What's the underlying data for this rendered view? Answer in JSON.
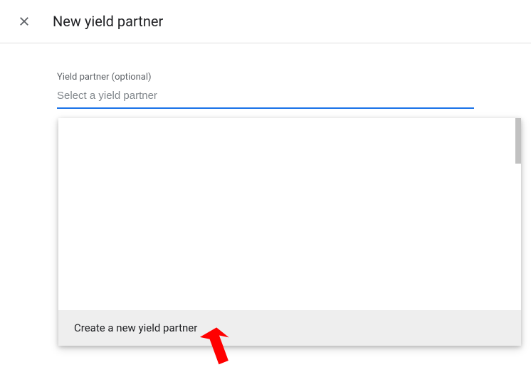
{
  "header": {
    "title": "New yield partner"
  },
  "form": {
    "field_label": "Yield partner (optional)",
    "select_placeholder": "Select a yield partner"
  },
  "dropdown": {
    "create_label": "Create a new yield partner"
  }
}
